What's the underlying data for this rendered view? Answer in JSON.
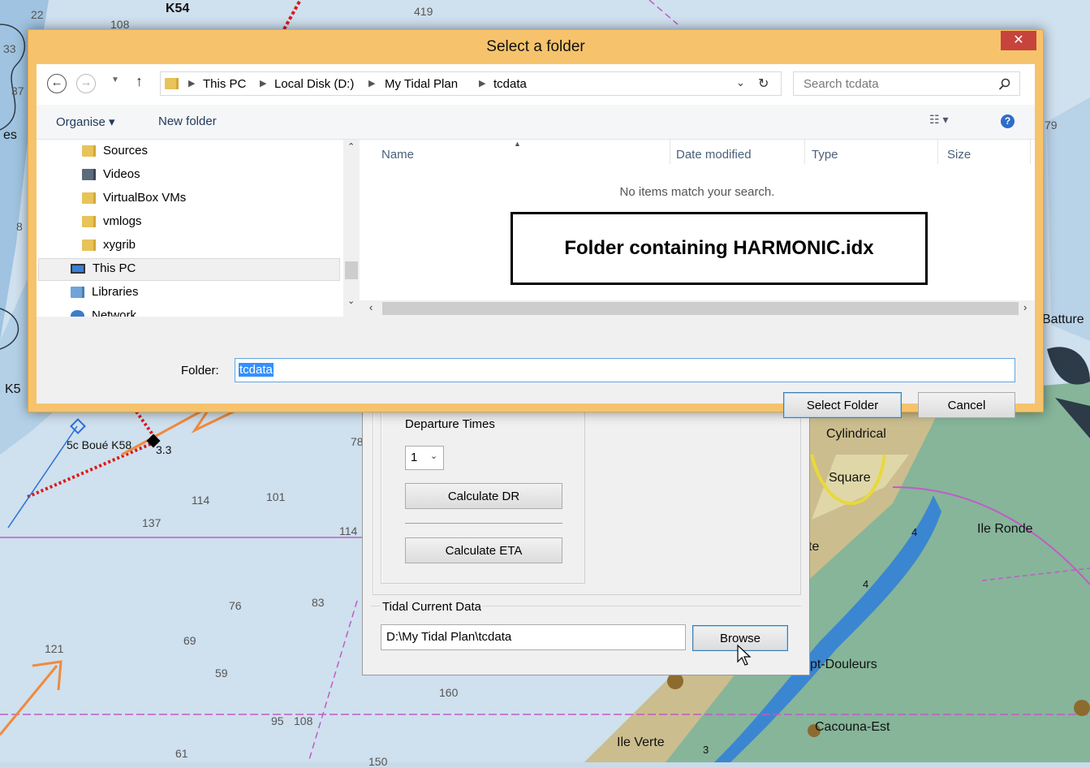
{
  "dialog": {
    "title": "Select a folder",
    "close": "✕",
    "breadcrumb": [
      "This PC",
      "Local Disk (D:)",
      "My Tidal Plan",
      "tcdata"
    ],
    "search_placeholder": "Search tcdata",
    "toolbar": {
      "organise": "Organise ▾",
      "new_folder": "New folder"
    },
    "tree": [
      "Sources",
      "Videos",
      "VirtualBox VMs",
      "vmlogs",
      "xygrib",
      "This PC",
      "Libraries",
      "Network"
    ],
    "columns": [
      "Name",
      "Date modified",
      "Type",
      "Size"
    ],
    "empty_message": "No items match your search.",
    "callout": "Folder containing HARMONIC.idx",
    "folder_label": "Folder:",
    "folder_value": "tcdata",
    "select_button": "Select Folder",
    "cancel_button": "Cancel"
  },
  "tidal_panel": {
    "departure_label": "Departure Times",
    "departure_value": "1",
    "calc_dr": "Calculate DR",
    "calc_eta": "Calculate ETA",
    "current_label": "Tidal Current Data",
    "path_value": "D:\\My Tidal Plan\\tcdata",
    "browse": "Browse"
  },
  "chart": {
    "soundings": [
      "22",
      "108",
      "419",
      "33",
      "37",
      "8",
      "78",
      "114",
      "101",
      "137",
      "114",
      "76",
      "83",
      "69",
      "121",
      "59",
      "160",
      "95",
      "108",
      "61",
      "150",
      "79"
    ],
    "places": [
      "K54",
      "K5",
      "5c Boué K58",
      "3.3",
      "Cylindrical",
      "Square",
      "Ile Ronde",
      "te",
      "Batture",
      "pt-Douleurs",
      "Cacouna-Est",
      "Ile Verte",
      "4",
      "4",
      "3",
      "es"
    ]
  }
}
